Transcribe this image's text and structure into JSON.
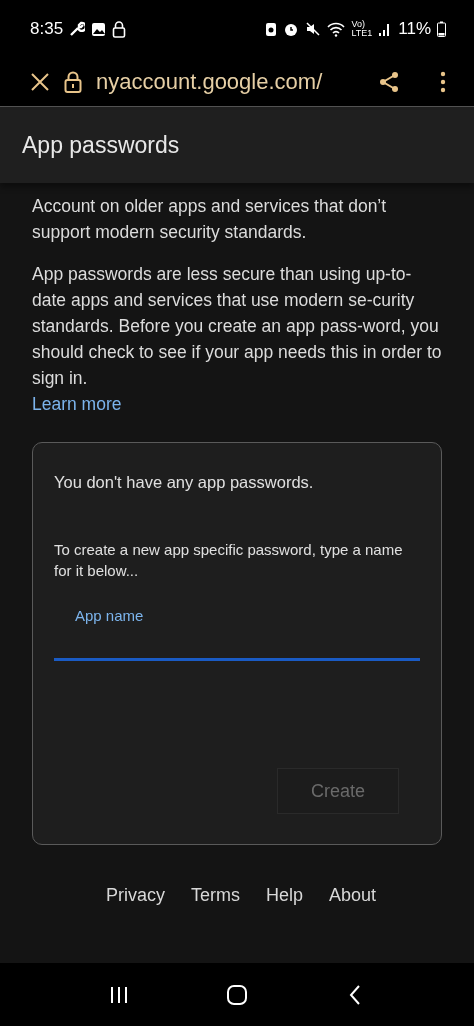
{
  "status_bar": {
    "time": "8:35",
    "network_top": "Vo)",
    "network_bottom": "LTE1",
    "battery": "11%"
  },
  "browser": {
    "url": "nyaccount.google.com/"
  },
  "page": {
    "title": "App passwords",
    "paragraphs": [
      "Account on older apps and services that don’t support modern security standards.",
      "App passwords are less secure than using up-to-date apps and services that use modern se-curity standards. Before you create an app pass-word, you should check to see if your app needs this in order to sign in."
    ],
    "learn_more": "Learn more",
    "card": {
      "empty_message": "You don't have any app passwords.",
      "instructions": "To create a new app specific password, type a name for it below...",
      "field": {
        "label": "App name",
        "focused": true
      },
      "button": {
        "label": "Create",
        "disabled": true
      }
    },
    "footer_links": [
      "Privacy",
      "Terms",
      "Help",
      "About"
    ]
  }
}
